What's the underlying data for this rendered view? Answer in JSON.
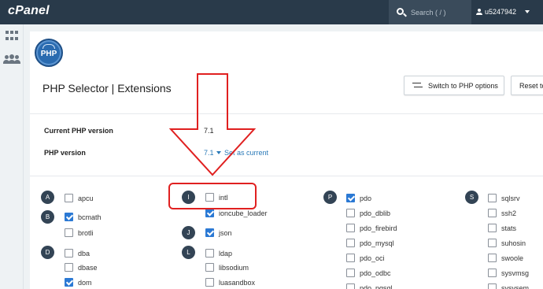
{
  "topbar": {
    "logo": "cPanel",
    "search_placeholder": "Search ( / )",
    "username": "u5247942"
  },
  "page": {
    "logo_text": "PHP",
    "title": "PHP Selector | Extensions",
    "switch_button": "Switch to PHP options",
    "reset_button": "Reset to"
  },
  "version": {
    "current_label": "Current PHP version",
    "current_value": "7.1",
    "php_label": "PHP version",
    "selected": "7.1",
    "set_link": "Set as current"
  },
  "letters": {
    "a": "A",
    "b": "B",
    "d": "D",
    "i": "I",
    "j": "J",
    "l": "L",
    "p": "P",
    "s": "S"
  },
  "extensions": {
    "apcu": {
      "label": "apcu",
      "checked": false
    },
    "bcmath": {
      "label": "bcmath",
      "checked": true
    },
    "brotli": {
      "label": "brotli",
      "checked": false
    },
    "dba": {
      "label": "dba",
      "checked": false
    },
    "dbase": {
      "label": "dbase",
      "checked": false
    },
    "dom": {
      "label": "dom",
      "checked": true
    },
    "intl": {
      "label": "intl",
      "checked": false
    },
    "ioncube": {
      "label": "ioncube_loader",
      "checked": true
    },
    "json": {
      "label": "json",
      "checked": true
    },
    "ldap": {
      "label": "ldap",
      "checked": false
    },
    "libsodium": {
      "label": "libsodium",
      "checked": false
    },
    "luasandbox": {
      "label": "luasandbox",
      "checked": false
    },
    "pdo": {
      "label": "pdo",
      "checked": true
    },
    "pdo_dblib": {
      "label": "pdo_dblib",
      "checked": false
    },
    "pdo_firebird": {
      "label": "pdo_firebird",
      "checked": false
    },
    "pdo_mysql": {
      "label": "pdo_mysql",
      "checked": false
    },
    "pdo_oci": {
      "label": "pdo_oci",
      "checked": false
    },
    "pdo_odbc": {
      "label": "pdo_odbc",
      "checked": false
    },
    "pdo_pgsql": {
      "label": "pdo_pgsql",
      "checked": false
    },
    "sqlsrv": {
      "label": "sqlsrv",
      "checked": false
    },
    "ssh2": {
      "label": "ssh2",
      "checked": false
    },
    "stats": {
      "label": "stats",
      "checked": false
    },
    "suhosin": {
      "label": "suhosin",
      "checked": false
    },
    "swoole": {
      "label": "swoole",
      "checked": false
    },
    "sysvmsg": {
      "label": "sysvmsg",
      "checked": false
    },
    "sysvsem": {
      "label": "sysvsem",
      "checked": false
    }
  },
  "colors": {
    "topbar": "#293a4a",
    "accent": "#2b79d4",
    "annotation": "#e02020"
  }
}
